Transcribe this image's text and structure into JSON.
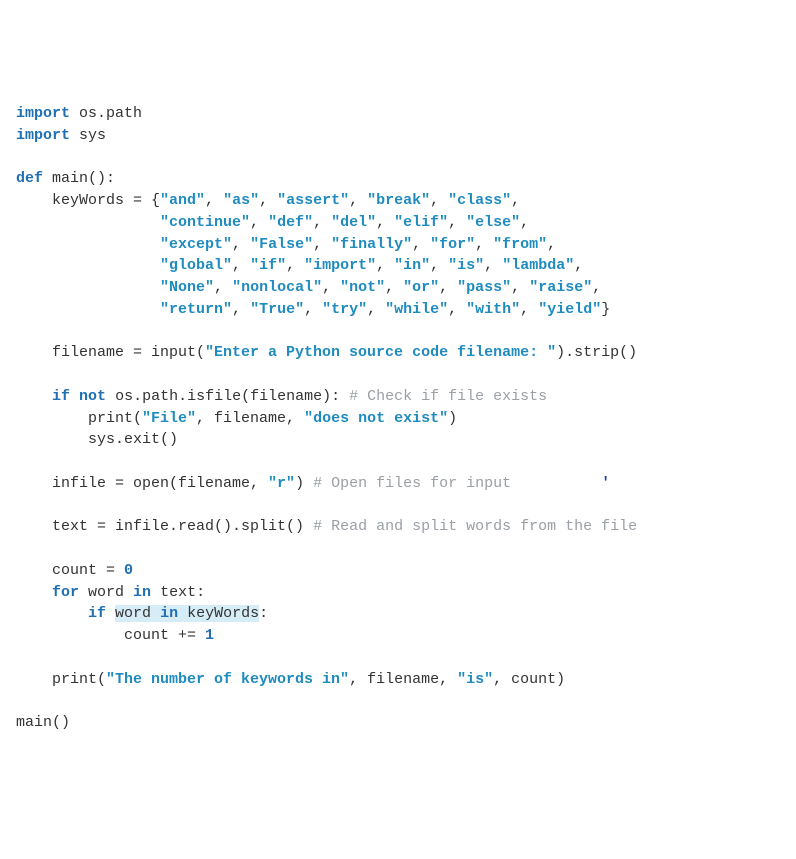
{
  "code": {
    "l1_kw1": "import",
    "l1_rest": " os.path",
    "l2_kw1": "import",
    "l2_rest": " sys",
    "blank": "",
    "l4_kw1": "def",
    "l4_rest": " main():",
    "l5_a": "    keyWords = {",
    "l5_s1": "\"and\"",
    "l5_c1": ", ",
    "l5_s2": "\"as\"",
    "l5_c2": ", ",
    "l5_s3": "\"assert\"",
    "l5_c3": ", ",
    "l5_s4": "\"break\"",
    "l5_c4": ", ",
    "l5_s5": "\"class\"",
    "l5_c5": ",",
    "l6_a": "                ",
    "l6_s1": "\"continue\"",
    "l6_c1": ", ",
    "l6_s2": "\"def\"",
    "l6_c2": ", ",
    "l6_s3": "\"del\"",
    "l6_c3": ", ",
    "l6_s4": "\"elif\"",
    "l6_c4": ", ",
    "l6_s5": "\"else\"",
    "l6_c5": ",",
    "l7_a": "                ",
    "l7_s1": "\"except\"",
    "l7_c1": ", ",
    "l7_s2": "\"False\"",
    "l7_c2": ", ",
    "l7_s3": "\"finally\"",
    "l7_c3": ", ",
    "l7_s4": "\"for\"",
    "l7_c4": ", ",
    "l7_s5": "\"from\"",
    "l7_c5": ",",
    "l8_a": "                ",
    "l8_s1": "\"global\"",
    "l8_c1": ", ",
    "l8_s2": "\"if\"",
    "l8_c2": ", ",
    "l8_s3": "\"import\"",
    "l8_c3": ", ",
    "l8_s4": "\"in\"",
    "l8_c4": ", ",
    "l8_s5": "\"is\"",
    "l8_c5": ", ",
    "l8_s6": "\"lambda\"",
    "l8_c6": ",",
    "l9_a": "                ",
    "l9_s1": "\"None\"",
    "l9_c1": ", ",
    "l9_s2": "\"nonlocal\"",
    "l9_c2": ", ",
    "l9_s3": "\"not\"",
    "l9_c3": ", ",
    "l9_s4": "\"or\"",
    "l9_c4": ", ",
    "l9_s5": "\"pass\"",
    "l9_c5": ", ",
    "l9_s6": "\"raise\"",
    "l9_c6": ",",
    "l10_a": "                ",
    "l10_s1": "\"return\"",
    "l10_c1": ", ",
    "l10_s2": "\"True\"",
    "l10_c2": ", ",
    "l10_s3": "\"try\"",
    "l10_c3": ", ",
    "l10_s4": "\"while\"",
    "l10_c4": ", ",
    "l10_s5": "\"with\"",
    "l10_c5": ", ",
    "l10_s6": "\"yield\"",
    "l10_c6": "}",
    "l12_a": "    filename = input(",
    "l12_s1": "\"Enter a Python source code filename: \"",
    "l12_b": ").strip()",
    "l14_a": "    ",
    "l14_kw1": "if",
    "l14_sp1": " ",
    "l14_kw2": "not",
    "l14_b": " os.path.isfile(filename): ",
    "l14_com": "# Check if file exists",
    "l15_a": "        print(",
    "l15_s1": "\"File\"",
    "l15_b": ", filename, ",
    "l15_s2": "\"does not exist\"",
    "l15_c": ")",
    "l16_a": "        sys.exit()",
    "l18_a": "    infile = open(filename, ",
    "l18_s1": "\"r\"",
    "l18_b": ") ",
    "l18_com": "# Open files for input",
    "l18_cur": "          '",
    "l20_a": "    text = infile.read().split() ",
    "l20_com": "# Read and split words from the file",
    "l22_a": "    count = ",
    "l22_n1": "0",
    "l23_a": "    ",
    "l23_kw1": "for",
    "l23_b": " word ",
    "l23_kw2": "in",
    "l23_c": " text:",
    "l24_a": "        ",
    "l24_kw1": "if",
    "l24_sp": " ",
    "l24_hl1": "word ",
    "l24_hlkw": "in",
    "l24_hl2": " keyWords",
    "l24_c": ":",
    "l25_a": "            count += ",
    "l25_n1": "1",
    "l27_a": "    print(",
    "l27_s1": "\"The number of keywords in\"",
    "l27_b": ", filename, ",
    "l27_s2": "\"is\"",
    "l27_c": ", count)",
    "l29_a": "main()"
  }
}
